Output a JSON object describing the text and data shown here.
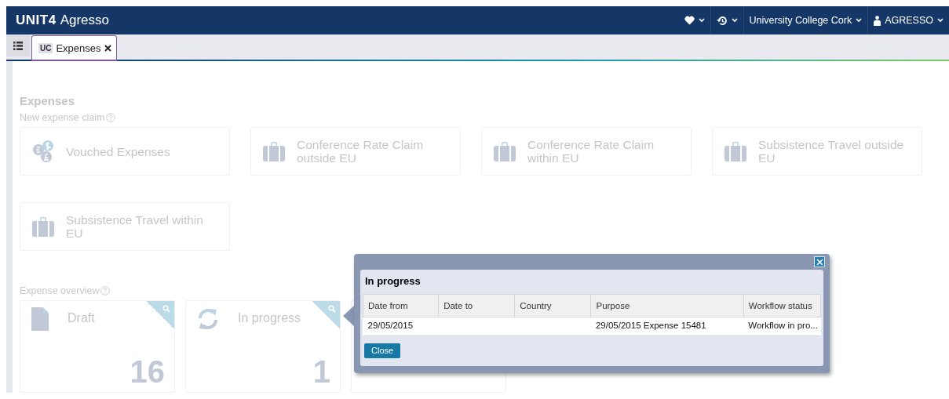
{
  "header": {
    "brand": "UNIT4",
    "product": "Agresso",
    "menus": [
      {
        "kind": "favorites"
      },
      {
        "kind": "history"
      },
      {
        "kind": "company",
        "label": "University College Cork"
      },
      {
        "kind": "user",
        "label": "AGRESSO"
      }
    ]
  },
  "tabs": [
    {
      "badge": "UC",
      "label": "Expenses",
      "selected": true
    }
  ],
  "page": {
    "title": "Expenses",
    "new_claim_label": "New expense claim",
    "claim_types": [
      {
        "kind": "currency",
        "label": "Vouched Expenses"
      },
      {
        "kind": "suitcase",
        "label": "Conference Rate Claim outside EU"
      },
      {
        "kind": "suitcase",
        "label": "Conference Rate Claim within EU"
      },
      {
        "kind": "suitcase",
        "label": "Subsistence Travel outside EU"
      },
      {
        "kind": "suitcase",
        "label": "Subsistence Travel within EU"
      }
    ],
    "overview_label": "Expense overview",
    "overview_tiles": [
      {
        "kind": "draft",
        "label": "Draft",
        "count": "16"
      },
      {
        "kind": "progress",
        "label": "In progress",
        "count": "1"
      },
      {
        "kind": "covered"
      }
    ]
  },
  "popup": {
    "title": "In progress",
    "columns": [
      "Date from",
      "Date to",
      "Country",
      "Purpose",
      "Workflow status"
    ],
    "rows": [
      {
        "date_from": "29/05/2015",
        "purpose": "29/05/2015 Expense 15481",
        "workflow_status": "Workflow in pro..."
      }
    ],
    "buttons": [
      "Close"
    ]
  }
}
